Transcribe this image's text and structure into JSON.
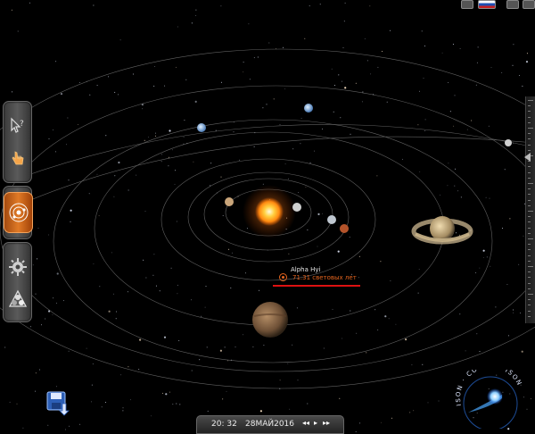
{
  "app": {
    "accent": "#e07a26",
    "label_color": "#e4641e"
  },
  "toolbar": {
    "top_group": [
      {
        "name": "select-help",
        "icon": "cursor-question-icon",
        "active": false
      },
      {
        "name": "hand",
        "icon": "hand-pointer-icon",
        "active": false
      }
    ],
    "middle_group": [
      {
        "name": "solar-system",
        "icon": "orbits-icon",
        "active": true
      }
    ],
    "bottom_group": [
      {
        "name": "settings",
        "icon": "gear-icon",
        "active": false
      },
      {
        "name": "view-mode",
        "icon": "triangle-circles-icon",
        "active": false
      }
    ]
  },
  "star_label": {
    "name": "Alpha Hyi",
    "distance": "71.31 световых лет"
  },
  "time_bar": {
    "time": "20: 32",
    "date": "28МАЙ2016",
    "controls": [
      "◂◂",
      "▸",
      "▸▸"
    ]
  },
  "logo": {
    "text": "ISON · COMET · ISON"
  },
  "bodies": {
    "sun": {
      "color": "#ffb040"
    },
    "saturn": {
      "color": "#d8c49a"
    },
    "jupiter": {
      "color": "#8a6a4a"
    }
  }
}
